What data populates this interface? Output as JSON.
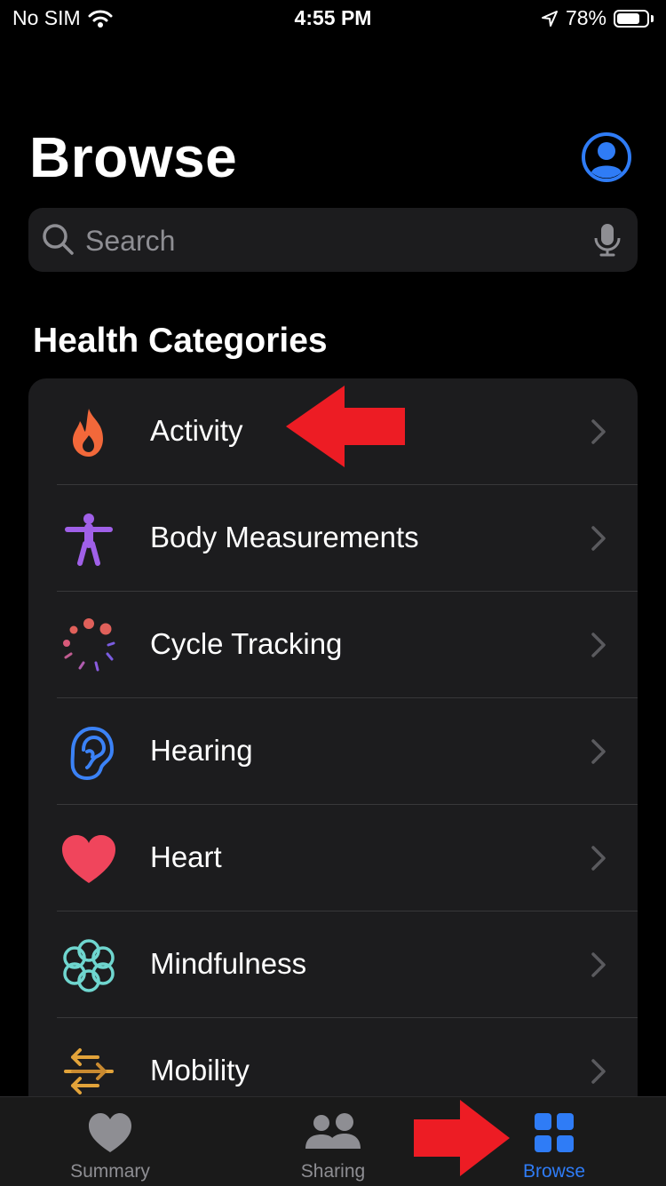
{
  "status_bar": {
    "carrier": "No SIM",
    "time": "4:55 PM",
    "battery_percent": "78%",
    "battery_level": 0.78
  },
  "header": {
    "title": "Browse",
    "profile_icon": "person-circle-icon"
  },
  "search": {
    "placeholder": "Search",
    "value": ""
  },
  "section": {
    "title": "Health Categories"
  },
  "categories": [
    {
      "label": "Activity",
      "icon": "flame-icon",
      "color": "#f2683a"
    },
    {
      "label": "Body Measurements",
      "icon": "figure-icon",
      "color": "#a060e8"
    },
    {
      "label": "Cycle Tracking",
      "icon": "cycle-dots-icon",
      "color": "#e0605a"
    },
    {
      "label": "Hearing",
      "icon": "ear-icon",
      "color": "#3b82f6"
    },
    {
      "label": "Heart",
      "icon": "heart-icon",
      "color": "#f0455c"
    },
    {
      "label": "Mindfulness",
      "icon": "flower-icon",
      "color": "#6fd6cf"
    },
    {
      "label": "Mobility",
      "icon": "arrows-icon",
      "color": "#e2a33a"
    }
  ],
  "tab_bar": {
    "tabs": [
      {
        "label": "Summary",
        "icon": "heart-icon",
        "active": false
      },
      {
        "label": "Sharing",
        "icon": "people-icon",
        "active": false
      },
      {
        "label": "Browse",
        "icon": "grid-icon",
        "active": true
      }
    ]
  },
  "colors": {
    "accent": "#2f7cf6",
    "annotation": "#ed1c24",
    "row_background": "#1c1c1e"
  }
}
